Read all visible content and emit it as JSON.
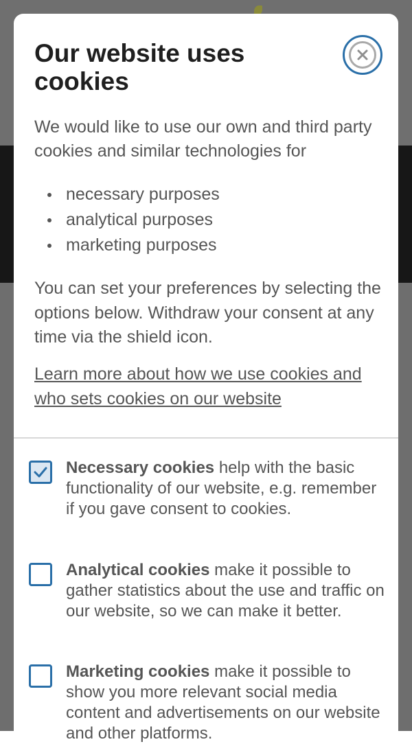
{
  "modal": {
    "title": "Our website uses cookies",
    "intro": "We would like to use our own and third party cookies and similar technologies for",
    "purposes": [
      "necessary purposes",
      "analytical purposes",
      "marketing purposes"
    ],
    "preferences_text": "You can set your preferences by selecting the options below. Withdraw your consent at any time via the shield icon.",
    "learn_more_link": "Learn more about how we use cookies and who sets cookies on our website",
    "close_icon": "close-icon"
  },
  "options": [
    {
      "label": "Necessary cookies",
      "description": " help with the basic functionality of our website, e.g. remember if you gave consent to cookies.",
      "checked": true
    },
    {
      "label": "Analytical cookies",
      "description": " make it possible to gather statistics about the use and traffic on our website, so we can make it better.",
      "checked": false
    },
    {
      "label": "Marketing cookies",
      "description": " make it possible to show you more relevant social media content and advertisements on our website and other platforms.",
      "checked": false
    }
  ],
  "colors": {
    "accent": "#2a6fa8",
    "text": "#555555",
    "title": "#1f1f1f",
    "overlay": "#6e6e6e"
  }
}
